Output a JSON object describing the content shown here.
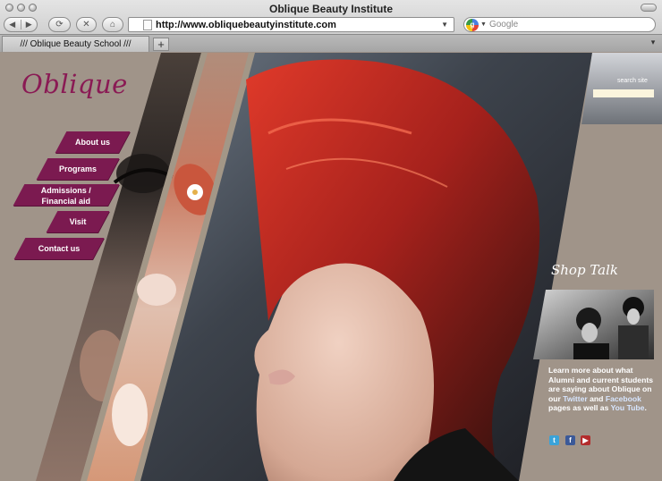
{
  "window": {
    "title": "Oblique Beauty Institute"
  },
  "toolbar": {
    "url": "http://www.obliquebeautyinstitute.com",
    "search_placeholder": "Google"
  },
  "tabs": [
    {
      "label": "/// Oblique Beauty School ///"
    }
  ],
  "site": {
    "logo": "Oblique",
    "nav": [
      {
        "label": "About us"
      },
      {
        "label": "Programs"
      },
      {
        "label": "Admissions /",
        "label2": "Financial aid"
      },
      {
        "label": "Visit"
      },
      {
        "label": "Contact us"
      }
    ],
    "search_label": "search site",
    "shop_talk": {
      "heading": "Shop Talk",
      "text1": "Learn more about what Alumni and current students are saying about Oblique on our ",
      "link_twitter": "Twitter",
      "text2": " and ",
      "link_facebook": "Facebook",
      "text3": " pages as well as ",
      "link_youtube": "You Tube",
      "text4": "."
    }
  },
  "colors": {
    "accent": "#7b1a50",
    "page_bg": "#a09489",
    "search_field": "#fbf5dd"
  }
}
